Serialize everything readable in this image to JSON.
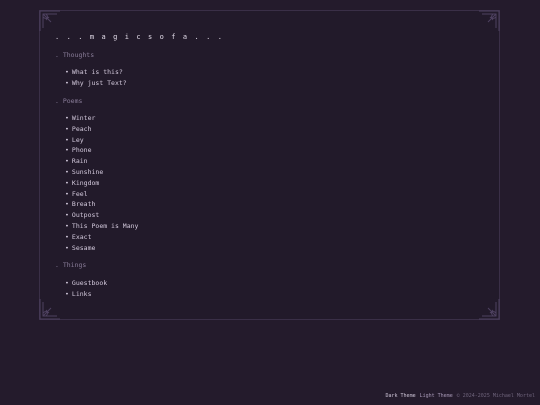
{
  "site": {
    "title": ". . . m a g i c s o f a . . ."
  },
  "sections": [
    {
      "label": ". Thoughts",
      "items": [
        "What is this?",
        "Why just Text?"
      ]
    },
    {
      "label": ". Poems",
      "items": [
        "Winter",
        "Peach",
        "Ley",
        "Phone",
        "Rain",
        "Sunshine",
        "Kingdom",
        "Feel",
        "Breath",
        "Outpost",
        "This Poem is Many",
        "Exact",
        "Sesame"
      ]
    },
    {
      "label": ". Things",
      "items": [
        "Guestbook",
        "Links"
      ]
    }
  ],
  "footer": {
    "dark_theme": "Dark Theme",
    "light_theme": "Light Theme",
    "copyright": "© 2024-2025 Michael Mortel"
  },
  "colors": {
    "background": "#241b2c",
    "text": "#d4cadd",
    "muted": "#8a7d99",
    "border": "#3a2f47"
  },
  "icons": {
    "corner": "ornament-corner-icon",
    "bullet": "bullet-dot-icon"
  }
}
